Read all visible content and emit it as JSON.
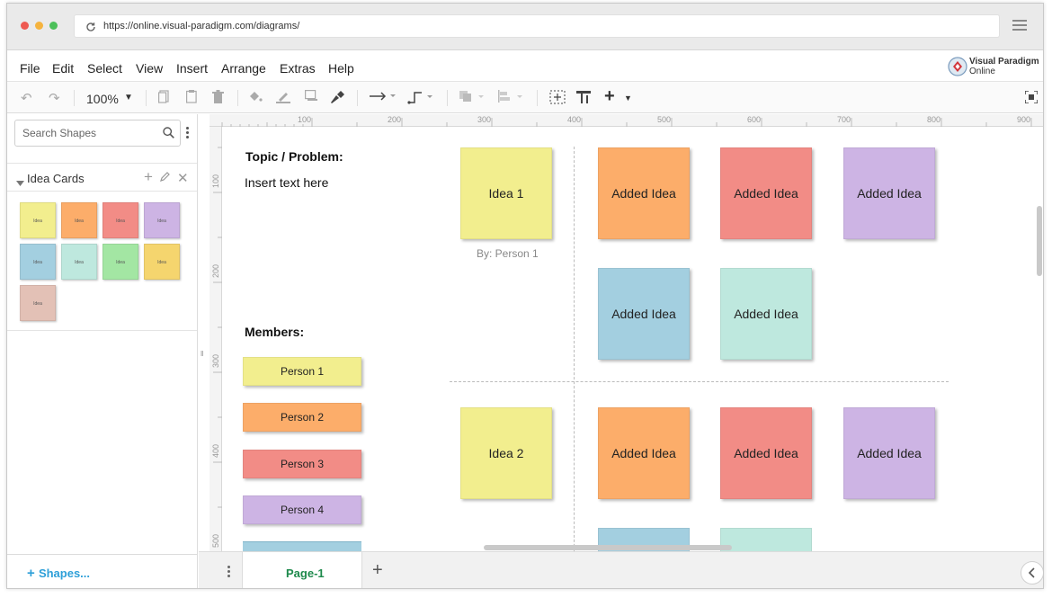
{
  "browser": {
    "url": "https://online.visual-paradigm.com/diagrams/",
    "dot_colors": [
      "#ee5a52",
      "#f5b33e",
      "#4cc05a"
    ]
  },
  "menu": {
    "items": [
      "File",
      "Edit",
      "Select",
      "View",
      "Insert",
      "Arrange",
      "Extras",
      "Help"
    ],
    "logo_line1": "Visual Paradigm",
    "logo_line2": "Online"
  },
  "toolbar": {
    "zoom": "100%"
  },
  "sidebar": {
    "search_placeholder": "Search Shapes",
    "section_title": "Idea Cards",
    "palette": [
      {
        "label": "Idea",
        "color": "#f2ee8e"
      },
      {
        "label": "Idea",
        "color": "#fcad6a"
      },
      {
        "label": "Idea",
        "color": "#f28c86"
      },
      {
        "label": "Idea",
        "color": "#cdb4e4"
      },
      {
        "label": "Idea",
        "color": "#a3cfe0"
      },
      {
        "label": "Idea",
        "color": "#bee8de"
      },
      {
        "label": "Idea",
        "color": "#a3e6a3"
      },
      {
        "label": "Idea",
        "color": "#f5d56e"
      },
      {
        "label": "Idea",
        "color": "#e3c1b6"
      }
    ],
    "footer_link": "Shapes..."
  },
  "rulers": {
    "top": [
      "100",
      "200",
      "300",
      "400",
      "500",
      "600",
      "700",
      "800",
      "900"
    ],
    "left": [
      "100",
      "200",
      "300",
      "400",
      "500"
    ]
  },
  "board": {
    "topic_label": "Topic / Problem:",
    "topic_text": "Insert text here",
    "members_label": "Members:",
    "members": [
      {
        "name": "Person 1",
        "color": "#f2ee8e"
      },
      {
        "name": "Person 2",
        "color": "#fcad6a"
      },
      {
        "name": "Person 3",
        "color": "#f28c86"
      },
      {
        "name": "Person 4",
        "color": "#cdb4e4"
      }
    ],
    "idea1": {
      "text": "Idea 1",
      "byline": "By: Person 1"
    },
    "idea2": {
      "text": "Idea 2"
    },
    "added_label": "Added Idea",
    "colors": {
      "yellow": "#f2ee8e",
      "orange": "#fcad6a",
      "red": "#f28c86",
      "purple": "#cdb4e4",
      "blue": "#a3cfe0",
      "mint": "#bee8de"
    }
  },
  "pagebar": {
    "page_tab": "Page-1"
  }
}
